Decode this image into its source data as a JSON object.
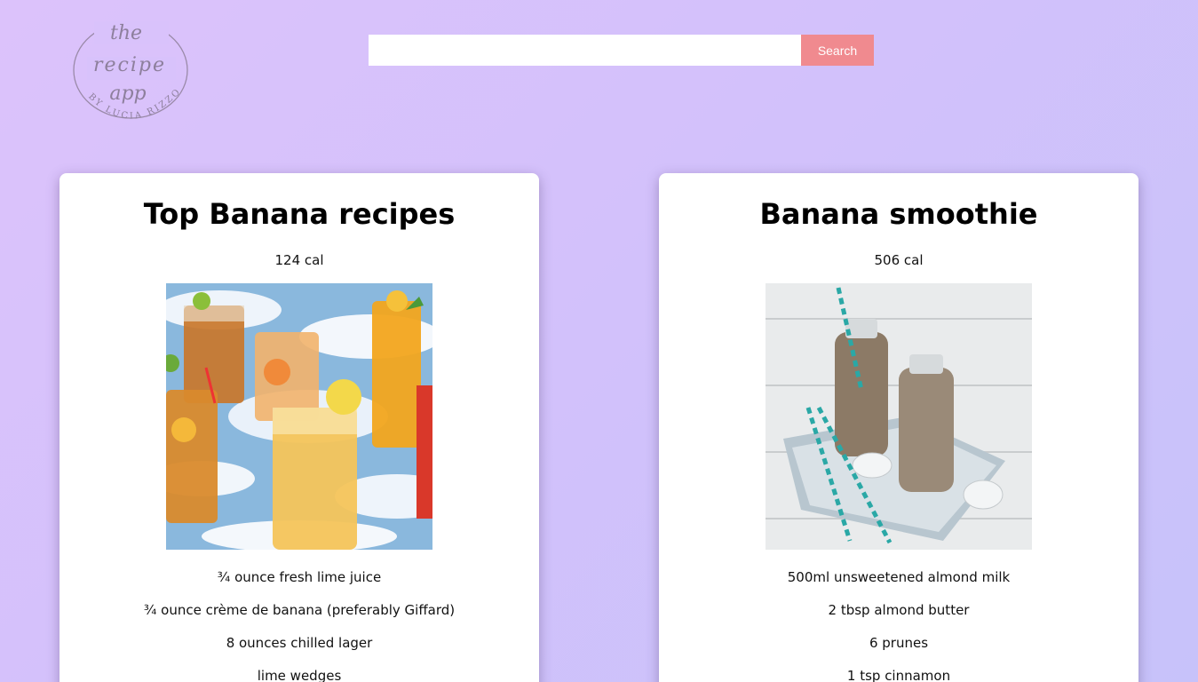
{
  "logo": {
    "line1": "the",
    "line2": "recipe",
    "line3": "app",
    "byline": "BY LUCIA RIZZO"
  },
  "search": {
    "value": "",
    "placeholder": "",
    "button_label": "Search"
  },
  "recipes": [
    {
      "title": "Top Banana recipes",
      "calories": "124 cal",
      "image_alt": "iced drinks on blue sky tablecloth",
      "ingredients": [
        "¾ ounce fresh lime juice",
        "¾ ounce crème de banana (preferably Giffard)",
        "8 ounces chilled lager",
        "lime wedges"
      ]
    },
    {
      "title": "Banana smoothie",
      "calories": "506 cal",
      "image_alt": "smoothie bottles with straws",
      "ingredients": [
        "500ml unsweetened almond milk",
        "2 tbsp almond butter",
        "6 prunes",
        "1 tsp cinnamon"
      ]
    }
  ]
}
